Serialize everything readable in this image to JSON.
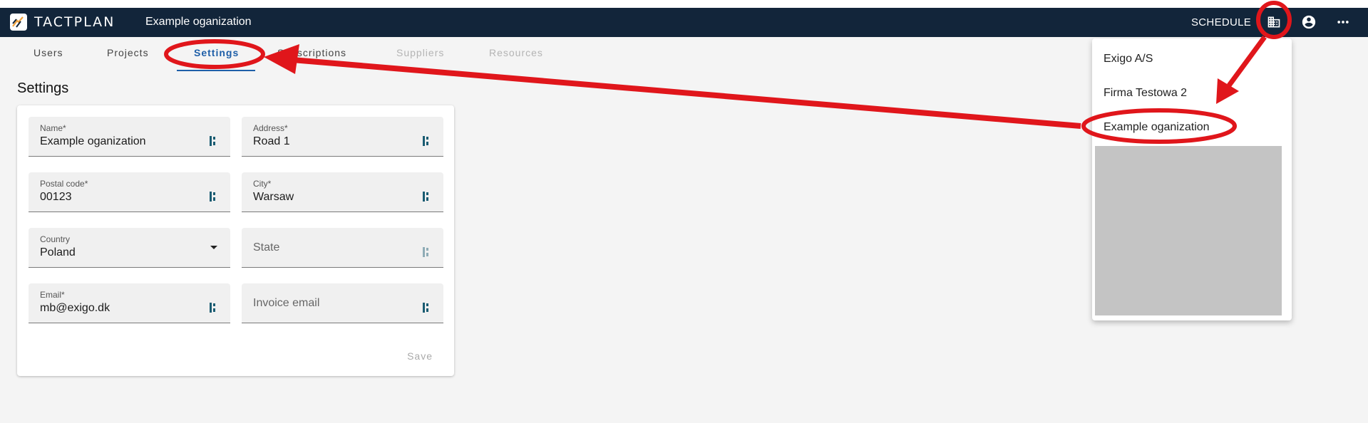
{
  "app": {
    "logo_text": "TACTPLAN",
    "org_name": "Example oganization"
  },
  "header": {
    "schedule_label": "SCHEDULE"
  },
  "tabs": [
    {
      "label": "Users"
    },
    {
      "label": "Projects"
    },
    {
      "label": "Settings"
    },
    {
      "label": "Subscriptions"
    },
    {
      "label": "Suppliers"
    },
    {
      "label": "Resources"
    }
  ],
  "page": {
    "title": "Settings"
  },
  "form": {
    "name": {
      "label": "Name*",
      "value": "Example oganization"
    },
    "address": {
      "label": "Address*",
      "value": "Road 1"
    },
    "postal": {
      "label": "Postal code*",
      "value": "00123"
    },
    "city": {
      "label": "City*",
      "value": "Warsaw"
    },
    "country": {
      "label": "Country",
      "value": "Poland"
    },
    "state": {
      "placeholder": "State"
    },
    "email": {
      "label": "Email*",
      "value": "mb@exigo.dk"
    },
    "invoice_email": {
      "placeholder": "Invoice email"
    },
    "save_label": "Save"
  },
  "org_menu": {
    "items": [
      {
        "label": "Exigo A/S"
      },
      {
        "label": "Firma Testowa 2"
      },
      {
        "label": "Example oganization"
      }
    ]
  },
  "colors": {
    "appbar": "#12253a",
    "accent": "#1f5fa8",
    "annotation": "#e0161b"
  },
  "icons": [
    "logo-icon",
    "building-icon",
    "account-circle-icon",
    "more-horizontal-icon",
    "field-handle-icon",
    "dropdown-caret-icon"
  ]
}
